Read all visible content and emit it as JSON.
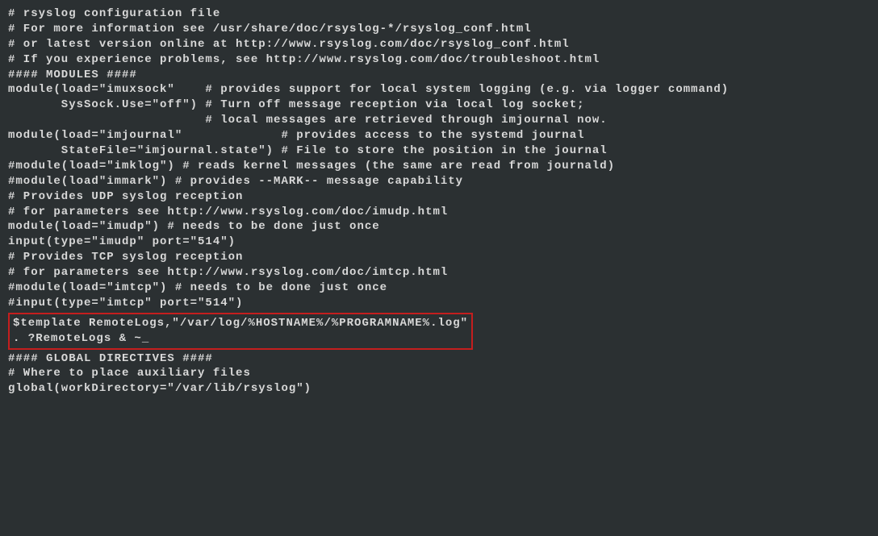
{
  "lines": {
    "l1": "# rsyslog configuration file",
    "l2": "",
    "l3": "# For more information see /usr/share/doc/rsyslog-*/rsyslog_conf.html",
    "l4": "# or latest version online at http://www.rsyslog.com/doc/rsyslog_conf.html",
    "l5": "# If you experience problems, see http://www.rsyslog.com/doc/troubleshoot.html",
    "l6": "",
    "l7": "#### MODULES ####",
    "l8": "",
    "l9": "module(load=\"imuxsock\"    # provides support for local system logging (e.g. via logger command)",
    "l10": "       SysSock.Use=\"off\") # Turn off message reception via local log socket;",
    "l11": "                          # local messages are retrieved through imjournal now.",
    "l12": "module(load=\"imjournal\"             # provides access to the systemd journal",
    "l13": "       StateFile=\"imjournal.state\") # File to store the position in the journal",
    "l14": "#module(load=\"imklog\") # reads kernel messages (the same are read from journald)",
    "l15": "#module(load\"immark\") # provides --MARK-- message capability",
    "l16": "",
    "l17": "# Provides UDP syslog reception",
    "l18": "# for parameters see http://www.rsyslog.com/doc/imudp.html",
    "l19": "module(load=\"imudp\") # needs to be done just once",
    "l20": "input(type=\"imudp\" port=\"514\")",
    "l21": "",
    "l22": "# Provides TCP syslog reception",
    "l23": "# for parameters see http://www.rsyslog.com/doc/imtcp.html",
    "l24": "#module(load=\"imtcp\") # needs to be done just once",
    "l25": "#input(type=\"imtcp\" port=\"514\")",
    "l26": "",
    "l27": "$template RemoteLogs,\"/var/log/%HOSTNAME%/%PROGRAMNAME%.log\"",
    "l28": ". ?RemoteLogs & ~_",
    "l29": "",
    "l30": "#### GLOBAL DIRECTIVES ####",
    "l31": "",
    "l32": "# Where to place auxiliary files",
    "l33": "global(workDirectory=\"/var/lib/rsyslog\")"
  }
}
